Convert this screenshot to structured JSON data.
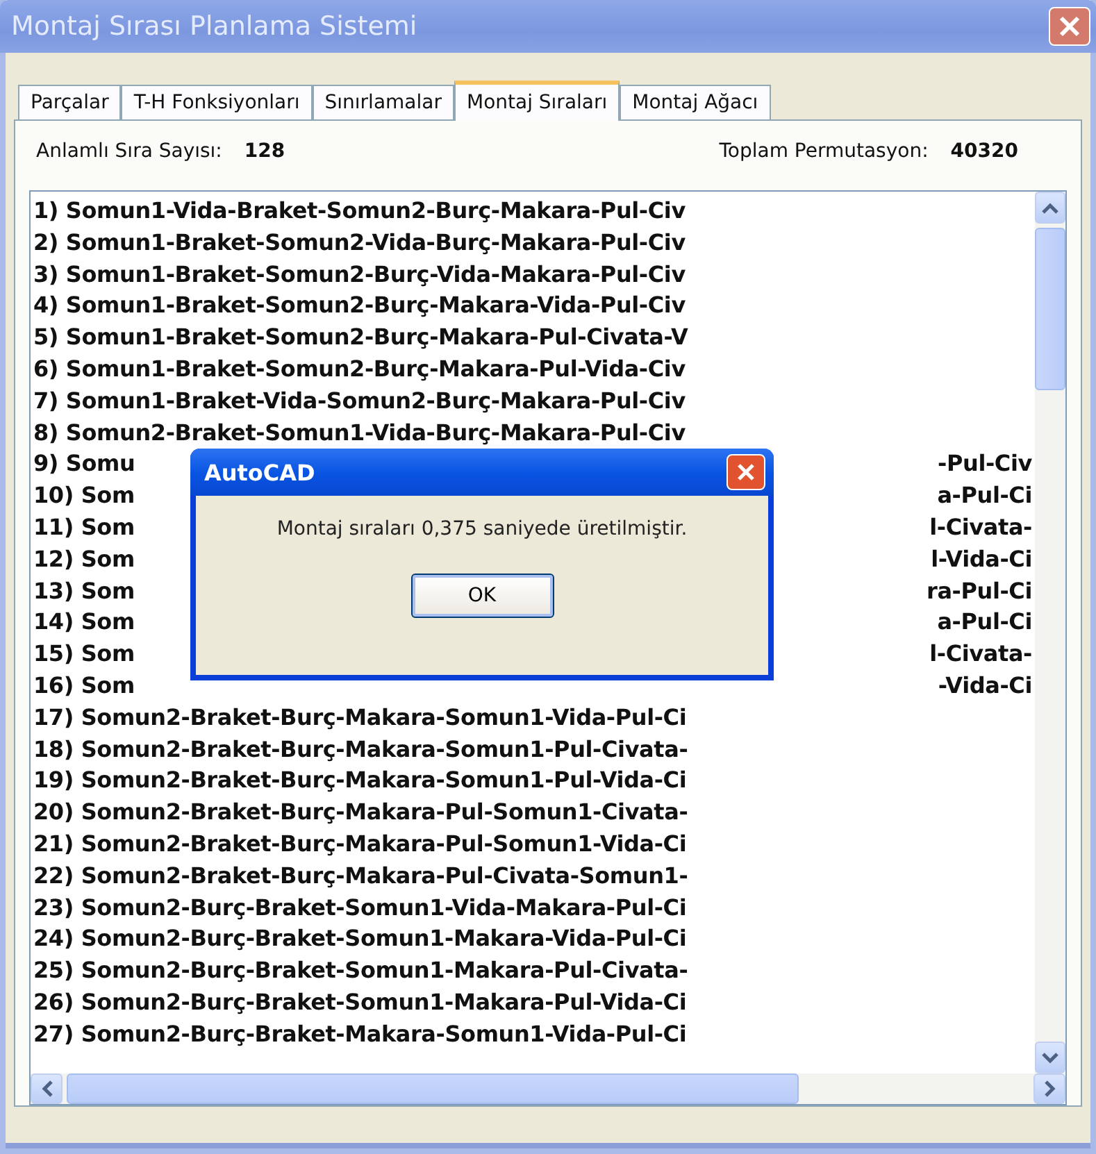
{
  "window": {
    "title": "Montaj Sırası Planlama Sistemi"
  },
  "tabs": [
    {
      "label": "Parçalar",
      "selected": false
    },
    {
      "label": "T-H Fonksiyonları",
      "selected": false
    },
    {
      "label": "Sınırlamalar",
      "selected": false
    },
    {
      "label": "Montaj Sıraları",
      "selected": true
    },
    {
      "label": "Montaj Ağacı",
      "selected": false
    }
  ],
  "stats": [
    {
      "label": "Anlamlı Sıra Sayısı:",
      "value": "128"
    },
    {
      "label": "Toplam Permutasyon:",
      "value": "40320"
    }
  ],
  "sequences": [
    {
      "kind": "full",
      "text": "1) Somun1-Vida-Braket-Somun2-Burç-Makara-Pul-Civ"
    },
    {
      "kind": "full",
      "text": "2) Somun1-Braket-Somun2-Vida-Burç-Makara-Pul-Civ"
    },
    {
      "kind": "full",
      "text": "3) Somun1-Braket-Somun2-Burç-Vida-Makara-Pul-Civ"
    },
    {
      "kind": "full",
      "text": "4) Somun1-Braket-Somun2-Burç-Makara-Vida-Pul-Civ"
    },
    {
      "kind": "full",
      "text": "5) Somun1-Braket-Somun2-Burç-Makara-Pul-Civata-V"
    },
    {
      "kind": "full",
      "text": "6) Somun1-Braket-Somun2-Burç-Makara-Pul-Vida-Civ"
    },
    {
      "kind": "full",
      "text": "7) Somun1-Braket-Vida-Somun2-Burç-Makara-Pul-Civ"
    },
    {
      "kind": "full",
      "text": "8) Somun2-Braket-Somun1-Vida-Burç-Makara-Pul-Civ"
    },
    {
      "kind": "covered",
      "left": "9) Somu",
      "right": "-Pul-Civ"
    },
    {
      "kind": "covered",
      "left": "10) Som",
      "right": "a-Pul-Ci"
    },
    {
      "kind": "covered",
      "left": "11) Som",
      "right": "l-Civata-"
    },
    {
      "kind": "covered",
      "left": "12) Som",
      "right": "l-Vida-Ci"
    },
    {
      "kind": "covered",
      "left": "13) Som",
      "right": "ra-Pul-Ci"
    },
    {
      "kind": "covered",
      "left": "14) Som",
      "right": "a-Pul-Ci"
    },
    {
      "kind": "covered",
      "left": "15) Som",
      "right": "l-Civata-"
    },
    {
      "kind": "covered",
      "left": "16) Som",
      "right": "-Vida-Ci"
    },
    {
      "kind": "full",
      "text": "17) Somun2-Braket-Burç-Makara-Somun1-Vida-Pul-Ci"
    },
    {
      "kind": "full",
      "text": "18) Somun2-Braket-Burç-Makara-Somun1-Pul-Civata-"
    },
    {
      "kind": "full",
      "text": "19) Somun2-Braket-Burç-Makara-Somun1-Pul-Vida-Ci"
    },
    {
      "kind": "full",
      "text": "20) Somun2-Braket-Burç-Makara-Pul-Somun1-Civata-"
    },
    {
      "kind": "full",
      "text": "21) Somun2-Braket-Burç-Makara-Pul-Somun1-Vida-Ci"
    },
    {
      "kind": "full",
      "text": "22) Somun2-Braket-Burç-Makara-Pul-Civata-Somun1-"
    },
    {
      "kind": "full",
      "text": "23) Somun2-Burç-Braket-Somun1-Vida-Makara-Pul-Ci"
    },
    {
      "kind": "full",
      "text": "24) Somun2-Burç-Braket-Somun1-Makara-Vida-Pul-Ci"
    },
    {
      "kind": "full",
      "text": "25) Somun2-Burç-Braket-Somun1-Makara-Pul-Civata-"
    },
    {
      "kind": "full",
      "text": "26) Somun2-Burç-Braket-Somun1-Makara-Pul-Vida-Ci"
    },
    {
      "kind": "full",
      "text": "27) Somun2-Burç-Braket-Makara-Somun1-Vida-Pul-Ci"
    }
  ],
  "dialog": {
    "title": "AutoCAD",
    "message": "Montaj sıraları 0,375 saniyede üretilmiştir.",
    "button": "OK"
  }
}
